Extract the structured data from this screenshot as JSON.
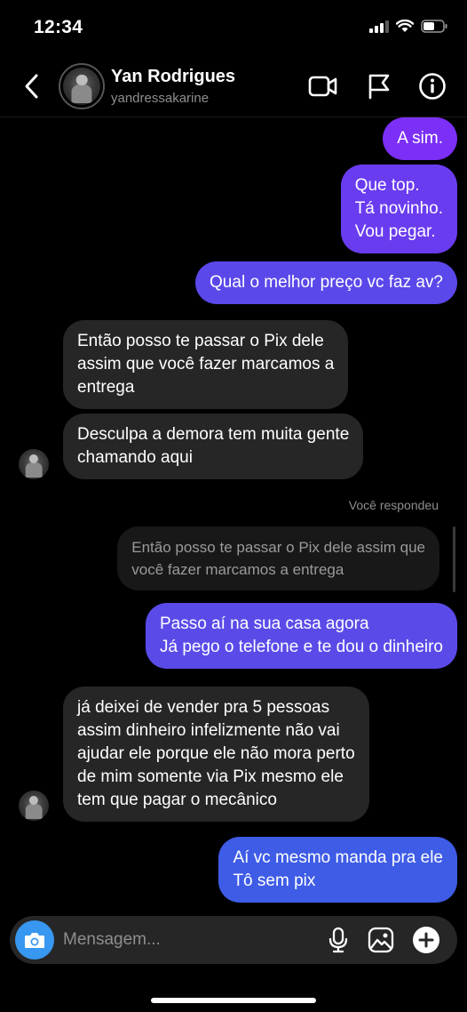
{
  "status_bar": {
    "time": "12:34"
  },
  "header": {
    "name": "Yan Rodrigues",
    "username": "yandressakarine"
  },
  "messages": [
    {
      "dir": "out",
      "lines": [
        "A sim."
      ]
    },
    {
      "dir": "out",
      "lines": [
        "Que top.",
        "Tá novinho.",
        "Vou pegar."
      ]
    },
    {
      "dir": "out",
      "lines": [
        "Qual o melhor preço vc faz av?"
      ]
    },
    {
      "dir": "in",
      "lines": [
        "Então posso te passar o Pix dele",
        "assim que você fazer marcamos a",
        "entrega"
      ]
    },
    {
      "dir": "in",
      "lines": [
        "Desculpa a demora tem muita gente",
        "chamando aqui"
      ]
    },
    {
      "dir": "out",
      "lines": [
        "Passo aí na sua casa agora",
        "Já pego o telefone e te dou o dinheiro"
      ]
    },
    {
      "dir": "in",
      "lines": [
        "já deixei de vender pra 5 pessoas",
        "assim dinheiro infelizmente não vai",
        "ajudar ele porque ele não mora perto",
        "de mim somente via Pix mesmo ele",
        "tem que pagar o mecânico"
      ]
    },
    {
      "dir": "out",
      "lines": [
        "Aí vc mesmo manda pra ele",
        "Tô sem pix"
      ]
    }
  ],
  "reply": {
    "label": "Você respondeu",
    "quoted_lines": [
      "Então posso te passar o Pix dele assim que",
      "você fazer marcamos a entrega"
    ]
  },
  "composer": {
    "placeholder": "Mensagem..."
  },
  "colors": {
    "background": "#000000",
    "incoming_bubble": "#262626",
    "outgoing_purple": "#7b2ff7",
    "outgoing_blue": "#3e5ce6",
    "camera_button": "#3897f0"
  },
  "icons": [
    "back-chevron-icon",
    "video-call-icon",
    "flag-icon",
    "info-icon",
    "camera-icon",
    "microphone-icon",
    "gallery-icon",
    "add-icon",
    "signal-icon",
    "wifi-icon",
    "battery-icon"
  ]
}
